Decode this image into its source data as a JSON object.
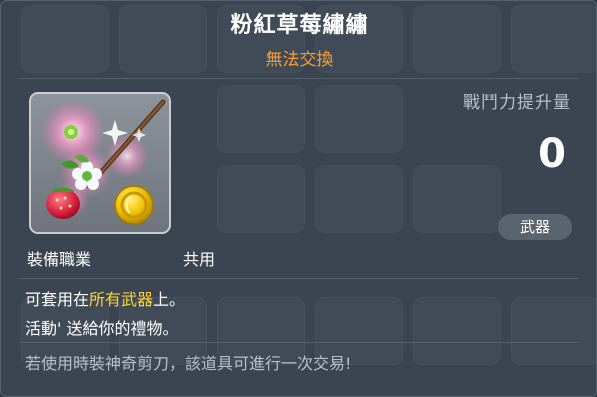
{
  "item": {
    "name": "粉紅草莓繡繡",
    "trade_status": "無法交換",
    "icon": "pink-strawberry-wand-icon"
  },
  "stats": {
    "power_label": "戰鬥力提升量",
    "power_value": "0",
    "category_badge": "武器"
  },
  "requirements": {
    "job_label": "裝備職業",
    "job_value": "共用"
  },
  "description": {
    "line1_prefix": "可套用在",
    "line1_highlight": "所有武器",
    "line1_suffix": "上。",
    "line2": "活動' 送給你的禮物。",
    "line3": "若使用時裝神奇剪刀，該道具可進行一次交易!"
  },
  "colors": {
    "background": "#3a4551",
    "title": "#ffffff",
    "trade_status": "#ff9d2b",
    "highlight": "#ffd52a",
    "muted_text": "#b9c0c7"
  }
}
